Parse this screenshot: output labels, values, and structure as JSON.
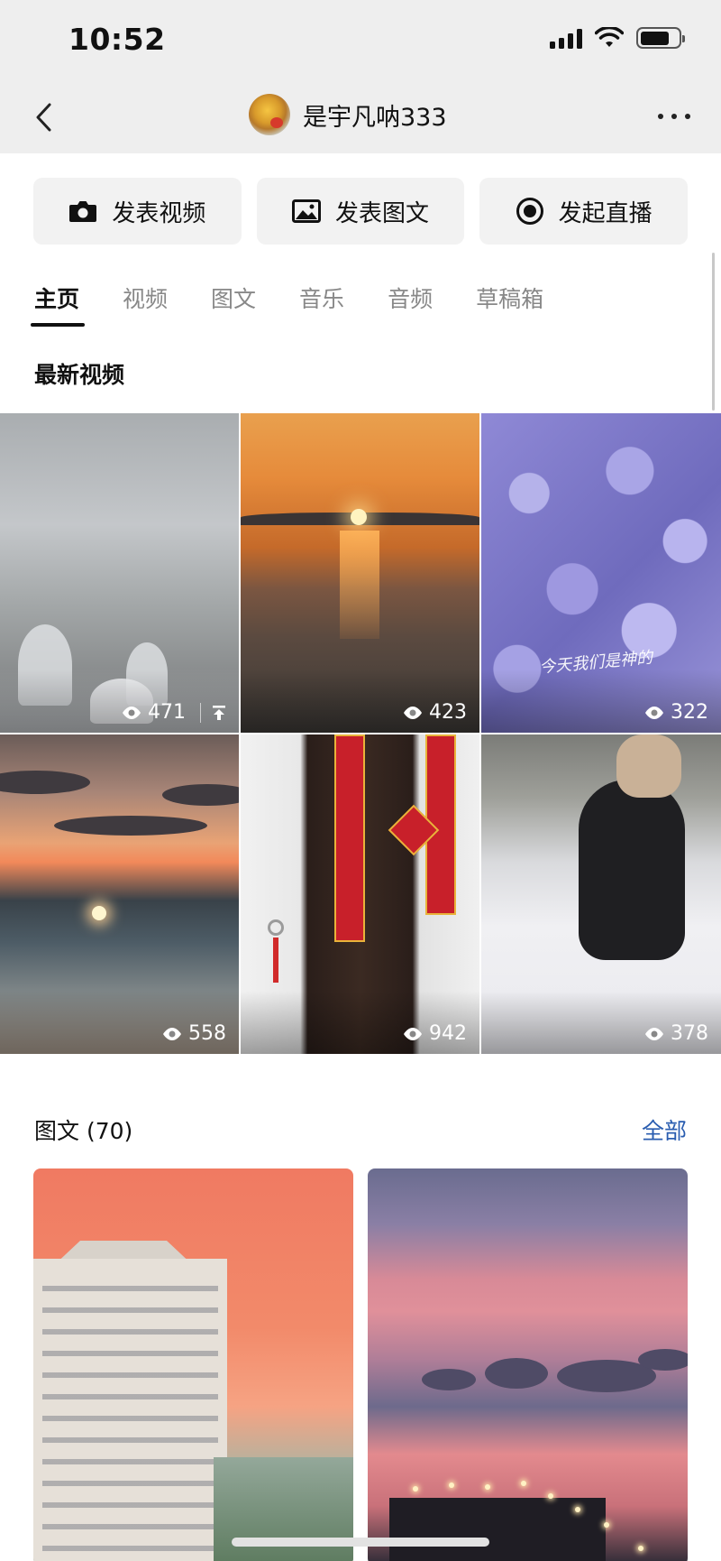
{
  "status_bar": {
    "time": "10:52"
  },
  "header": {
    "title": "是宇凡呐333"
  },
  "actions": [
    {
      "label": "发表视频",
      "icon": "camera-icon"
    },
    {
      "label": "发表图文",
      "icon": "image-icon"
    },
    {
      "label": "发起直播",
      "icon": "live-icon"
    }
  ],
  "tabs": [
    "主页",
    "视频",
    "图文",
    "音乐",
    "音频",
    "草稿箱"
  ],
  "active_tab": "主页",
  "latest_videos": {
    "title": "最新视频",
    "items": [
      {
        "views": "471",
        "pinned": true
      },
      {
        "views": "423"
      },
      {
        "views": "322",
        "overlay_text": "今天我们是神的"
      },
      {
        "views": "558"
      },
      {
        "views": "942"
      },
      {
        "views": "378"
      }
    ]
  },
  "posts_section": {
    "title": "图文 (70)",
    "all_label": "全部"
  }
}
